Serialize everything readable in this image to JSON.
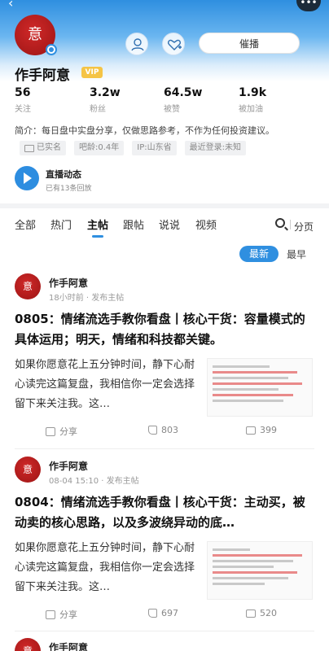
{
  "profile": {
    "avatar_char": "意",
    "name": "作手阿意",
    "vip": "VIP",
    "follow_btn": "催播",
    "stats": [
      {
        "num": "56",
        "label": "关注"
      },
      {
        "num": "3.2w",
        "label": "粉丝"
      },
      {
        "num": "64.5w",
        "label": "被赞"
      },
      {
        "num": "1.9k",
        "label": "被加油"
      }
    ],
    "bio": "简介：每日盘中实盘分享，仅做思路参考，不作为任何投资建议。",
    "tags": [
      "已实名",
      "吧龄:0.4年",
      "IP:山东省",
      "最近登录:未知"
    ],
    "live_title": "直播动态",
    "live_sub": "已有13条回放"
  },
  "tabs": [
    "全部",
    "热门",
    "主帖",
    "跟帖",
    "说说",
    "视频"
  ],
  "page_btn": "分页",
  "sort": {
    "new": "最新",
    "early": "最早"
  },
  "posts": [
    {
      "avatar_char": "意",
      "author": "作手阿意",
      "meta": "18小时前 · 发布主帖",
      "title": "0805：情绪流选手教你看盘丨核心干货：容量模式的具体运用；明天，情绪和科技都关键。",
      "excerpt": "如果你愿意花上五分钟时间，静下心耐心读完这篇复盘，我相信你一定会选择留下来关注我。这…",
      "share": "分享",
      "likes": "803",
      "comments": "399"
    },
    {
      "avatar_char": "意",
      "author": "作手阿意",
      "meta": "08-04 15:10 · 发布主帖",
      "title": "0804：情绪流选手教你看盘丨核心干货：主动买，被动卖的核心思路，以及多波绕异动的底…",
      "excerpt": "如果你愿意花上五分钟时间，静下心耐心读完这篇复盘，我相信你一定会选择留下来关注我。这…",
      "share": "分享",
      "likes": "697",
      "comments": "520"
    },
    {
      "avatar_char": "意",
      "author": "作手阿意"
    }
  ]
}
